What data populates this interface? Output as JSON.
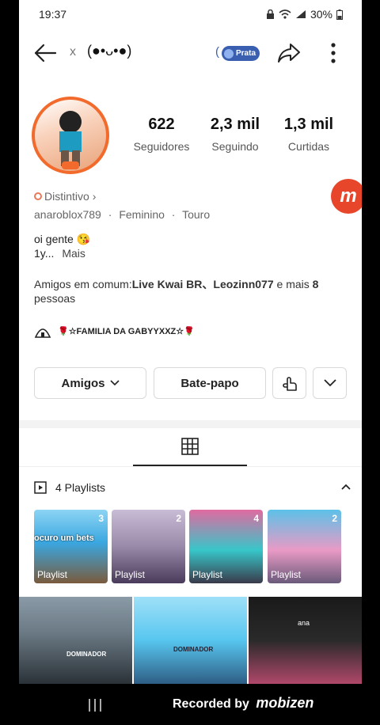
{
  "status_bar": {
    "time": "19:37",
    "battery": "30%"
  },
  "header": {
    "nickname_prefix": "x",
    "nickname": "(●•ᴗ•●)",
    "badge_label": "Prata"
  },
  "stats": [
    {
      "value": "622",
      "label": "Seguidores"
    },
    {
      "value": "2,3 mil",
      "label": "Seguindo"
    },
    {
      "value": "1,3 mil",
      "label": "Curtidas"
    }
  ],
  "profile": {
    "distintivo": "Distintivo",
    "username": "anaroblox789",
    "gender": "Feminino",
    "sign": "Touro",
    "bio_line1": "oi gente 😘",
    "bio_line2": "1y...",
    "bio_more": "Mais",
    "mutual_prefix": "Amigos em comum:",
    "mutual_names": "Live Kwai BR、Leozinn077",
    "mutual_and": " e mais ",
    "mutual_count": "8",
    "mutual_suffix": "pessoas",
    "family": "🌹☆FAMILIA DA GABYYXXZ☆🌹"
  },
  "actions": {
    "friends": "Amigos",
    "chat": "Bate-papo"
  },
  "playlists": {
    "title": "4 Playlists",
    "items": [
      {
        "label": "Playlist",
        "count": "3",
        "caption": "ocuro um bets",
        "color1": "#3aa7e0",
        "color2": "#7a5a3c"
      },
      {
        "label": "Playlist",
        "count": "2",
        "caption": "",
        "color1": "#b9a6c8",
        "color2": "#4a3b5a"
      },
      {
        "label": "Playlist",
        "count": "4",
        "caption": "",
        "color1": "#37c6c9",
        "color2": "#e06aa0"
      },
      {
        "label": "Playlist",
        "count": "2",
        "caption": "",
        "color1": "#5cc1e8",
        "color2": "#e99ac5"
      }
    ]
  },
  "videos": [
    {
      "caption": "DOMINADOR",
      "color1": "#6c7b86",
      "color2": "#2b3238"
    },
    {
      "caption": "DOMINADOR",
      "color1": "#57c6ef",
      "color2": "#2e5e85"
    },
    {
      "caption": "ana",
      "color1": "#2a2a2a",
      "color2": "#b0486a"
    }
  ],
  "watermark": {
    "text": "Recorded by",
    "brand": "mobizen"
  },
  "colors": {
    "accent": "#f26b2d",
    "badge": "#3a5fb0",
    "mobizen": "#e8462a"
  }
}
